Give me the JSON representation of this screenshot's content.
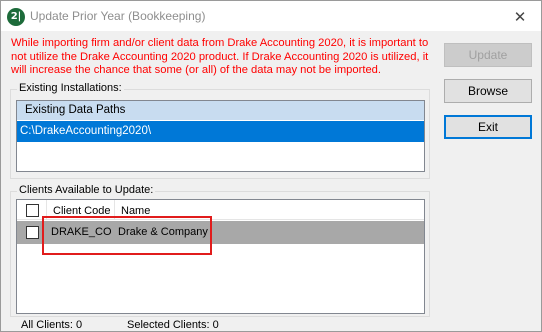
{
  "window": {
    "app_icon_text": "2|",
    "title": "Update Prior Year (Bookkeeping)",
    "close_glyph": "✕"
  },
  "warning_text": "While importing firm and/or client data from Drake Accounting 2020, it is important to not utilize the Drake Accounting 2020 product. If Drake Accounting 2020 is utilized, it will increase the chance that some (or all) of the data may not be imported.",
  "buttons": {
    "update": "Update",
    "browse": "Browse",
    "exit": "Exit"
  },
  "installations": {
    "label": "Existing Installations:",
    "column_header": "Existing Data Paths",
    "rows": [
      "C:\\DrakeAccounting2020\\"
    ]
  },
  "clients": {
    "label": "Clients Available to Update:",
    "columns": {
      "code": "Client Code",
      "name": "Name"
    },
    "rows": [
      {
        "checked": false,
        "code": "DRAKE_CO",
        "name": "Drake & Company"
      }
    ]
  },
  "status": {
    "all_clients": "All Clients: 0",
    "selected_clients": "Selected Clients: 0"
  },
  "colors": {
    "warning": "#ff0000",
    "selection": "#0078d7",
    "header_highlight": "#c8dcf0",
    "annotation_box": "#e11c1c"
  }
}
